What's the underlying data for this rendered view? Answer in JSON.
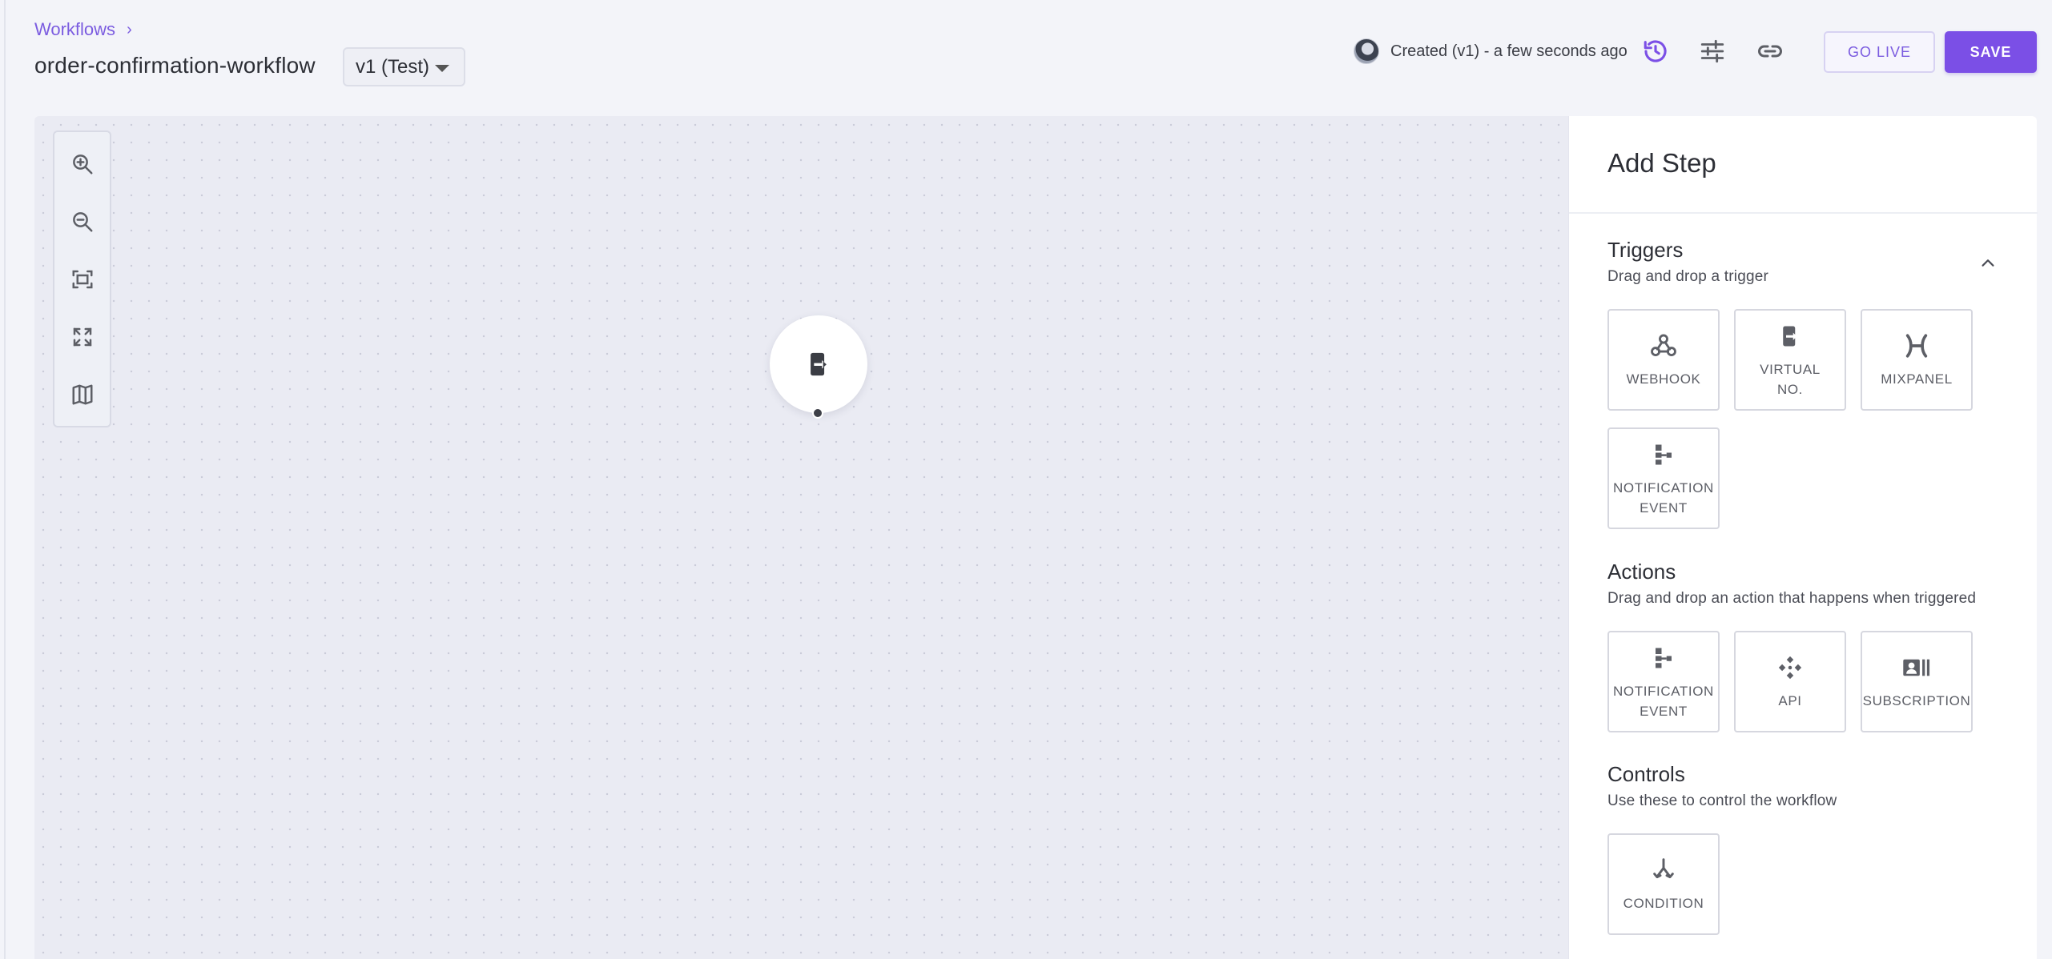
{
  "breadcrumb": {
    "root": "Workflows",
    "separator": "›"
  },
  "workflow": {
    "name": "order-confirmation-workflow",
    "version_selected": "v1 (Test)"
  },
  "header": {
    "status_text": "Created (v1) - a few seconds ago",
    "icons": [
      "history-icon",
      "sliders-icon",
      "link-icon"
    ],
    "go_live_label": "GO LIVE",
    "save_label": "SAVE"
  },
  "canvas": {
    "toolbar": [
      "zoom-in-icon",
      "zoom-out-icon",
      "fit-view-icon",
      "fullscreen-icon",
      "map-icon"
    ],
    "node_icon": "exit-phone-icon"
  },
  "panel": {
    "title": "Add Step",
    "triggers": {
      "title": "Triggers",
      "subtitle": "Drag and drop a trigger",
      "tiles": [
        {
          "label": "WEBHOOK",
          "icon": "webhook-icon"
        },
        {
          "label": "VIRTUAL\nNO.",
          "icon": "virtual-number-icon"
        },
        {
          "label": "MIXPANEL",
          "icon": "mixpanel-icon"
        },
        {
          "label": "NOTIFICATION\nEVENT",
          "icon": "notification-event-icon"
        }
      ]
    },
    "actions": {
      "title": "Actions",
      "subtitle": "Drag and drop an action that happens when triggered",
      "tiles": [
        {
          "label": "NOTIFICATION\nEVENT",
          "icon": "notification-event-icon"
        },
        {
          "label": "API",
          "icon": "api-icon"
        },
        {
          "label": "SUBSCRIPTION",
          "icon": "subscription-icon"
        }
      ]
    },
    "controls": {
      "title": "Controls",
      "subtitle": "Use these to control the workflow",
      "tiles": [
        {
          "label": "CONDITION",
          "icon": "condition-icon"
        }
      ]
    }
  },
  "colors": {
    "accent": "#7b4fe6",
    "link": "#7b5ce0",
    "canvas": "#eaebf3"
  }
}
